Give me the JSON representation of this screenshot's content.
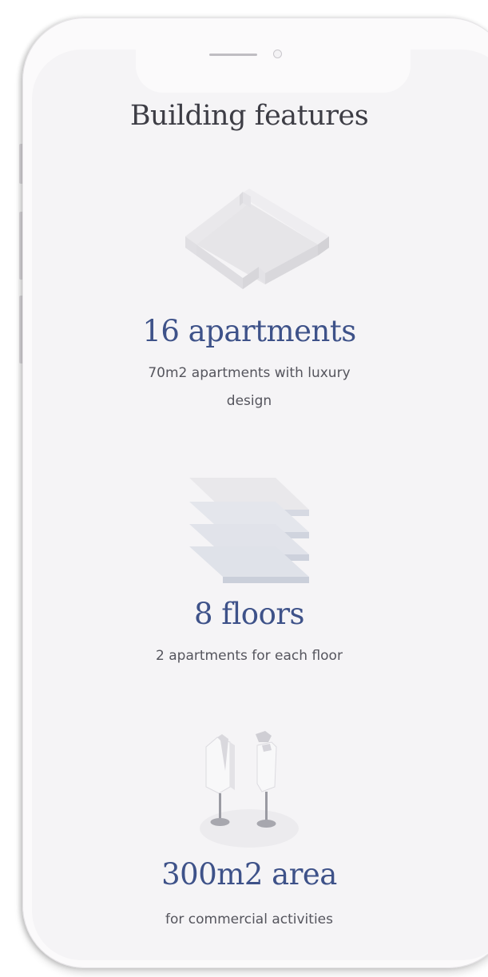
{
  "page": {
    "title": "Building features"
  },
  "features": [
    {
      "icon": "building-blocks-icon",
      "title": "16 apartments",
      "description": "70m2 apartments with luxury design"
    },
    {
      "icon": "stacked-floors-icon",
      "title": "8 floors",
      "description": "2 apartments for each floor"
    },
    {
      "icon": "mannequins-icon",
      "title": "300m2 area",
      "description": "for commercial activities"
    }
  ],
  "colors": {
    "accent": "#3e5289",
    "heading": "#3d3d45",
    "body_text": "#55555d",
    "screen_bg": "#f5f4f6"
  }
}
